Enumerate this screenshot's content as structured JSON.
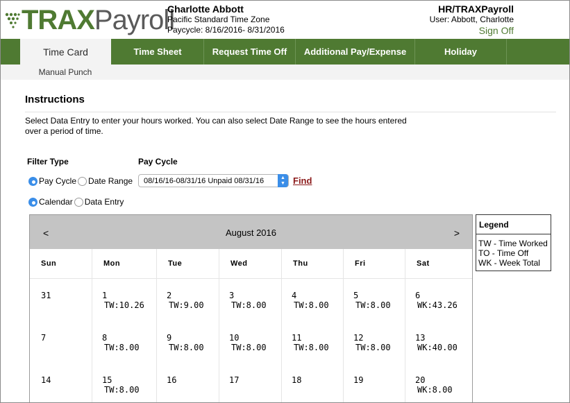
{
  "brand": {
    "trax": "TRAX",
    "payroll": "Payroll",
    "green": "#4f7a32"
  },
  "user": {
    "name": "Charlotte Abbott",
    "timezone": "Pacific Standard Time Zone",
    "paycycle": "Paycycle: 8/16/2016- 8/31/2016"
  },
  "account": {
    "company": "HR/TRAXPayroll",
    "user_line": "User: Abbott, Charlotte",
    "signout": "Sign Off"
  },
  "nav": {
    "tabs": [
      {
        "label": "Time Card",
        "active": true
      },
      {
        "label": "Time Sheet",
        "active": false
      },
      {
        "label": "Request Time Off",
        "active": false
      },
      {
        "label": "Additional Pay/Expense",
        "active": false
      },
      {
        "label": "Holiday",
        "active": false
      }
    ],
    "subnav": "Manual Punch"
  },
  "instructions": {
    "heading": "Instructions",
    "text": "Select Data Entry to enter your hours worked. You can also select Date Range to see the hours entered over a period of time."
  },
  "filter": {
    "filter_type_label": "Filter Type",
    "pay_cycle_label": "Pay Cycle",
    "options_row1": [
      {
        "label": "Pay Cycle",
        "selected": true
      },
      {
        "label": "Date Range",
        "selected": false
      }
    ],
    "options_row2": [
      {
        "label": "Calendar",
        "selected": true
      },
      {
        "label": "Data Entry",
        "selected": false
      }
    ],
    "pay_cycle_value": "08/16/16-08/31/16 Unpaid 08/31/16",
    "find": "Find"
  },
  "calendar": {
    "prev": "<",
    "next": ">",
    "month": "August 2016",
    "days_of_week": [
      "Sun",
      "Mon",
      "Tue",
      "Wed",
      "Thu",
      "Fri",
      "Sat"
    ],
    "weeks": [
      [
        {
          "num": "31",
          "val": ""
        },
        {
          "num": "1",
          "val": "TW:10.26"
        },
        {
          "num": "2",
          "val": "TW:9.00"
        },
        {
          "num": "3",
          "val": "TW:8.00"
        },
        {
          "num": "4",
          "val": "TW:8.00"
        },
        {
          "num": "5",
          "val": "TW:8.00"
        },
        {
          "num": "6",
          "val": "WK:43.26"
        }
      ],
      [
        {
          "num": "7",
          "val": ""
        },
        {
          "num": "8",
          "val": "TW:8.00"
        },
        {
          "num": "9",
          "val": "TW:8.00"
        },
        {
          "num": "10",
          "val": "TW:8.00"
        },
        {
          "num": "11",
          "val": "TW:8.00"
        },
        {
          "num": "12",
          "val": "TW:8.00"
        },
        {
          "num": "13",
          "val": "WK:40.00"
        }
      ],
      [
        {
          "num": "14",
          "val": ""
        },
        {
          "num": "15",
          "val": "TW:8.00"
        },
        {
          "num": "16",
          "val": ""
        },
        {
          "num": "17",
          "val": ""
        },
        {
          "num": "18",
          "val": ""
        },
        {
          "num": "19",
          "val": ""
        },
        {
          "num": "20",
          "val": "WK:8.00"
        }
      ]
    ]
  },
  "legend": {
    "title": "Legend",
    "items": [
      "TW - Time Worked",
      "TO - Time Off",
      "WK - Week Total"
    ]
  }
}
